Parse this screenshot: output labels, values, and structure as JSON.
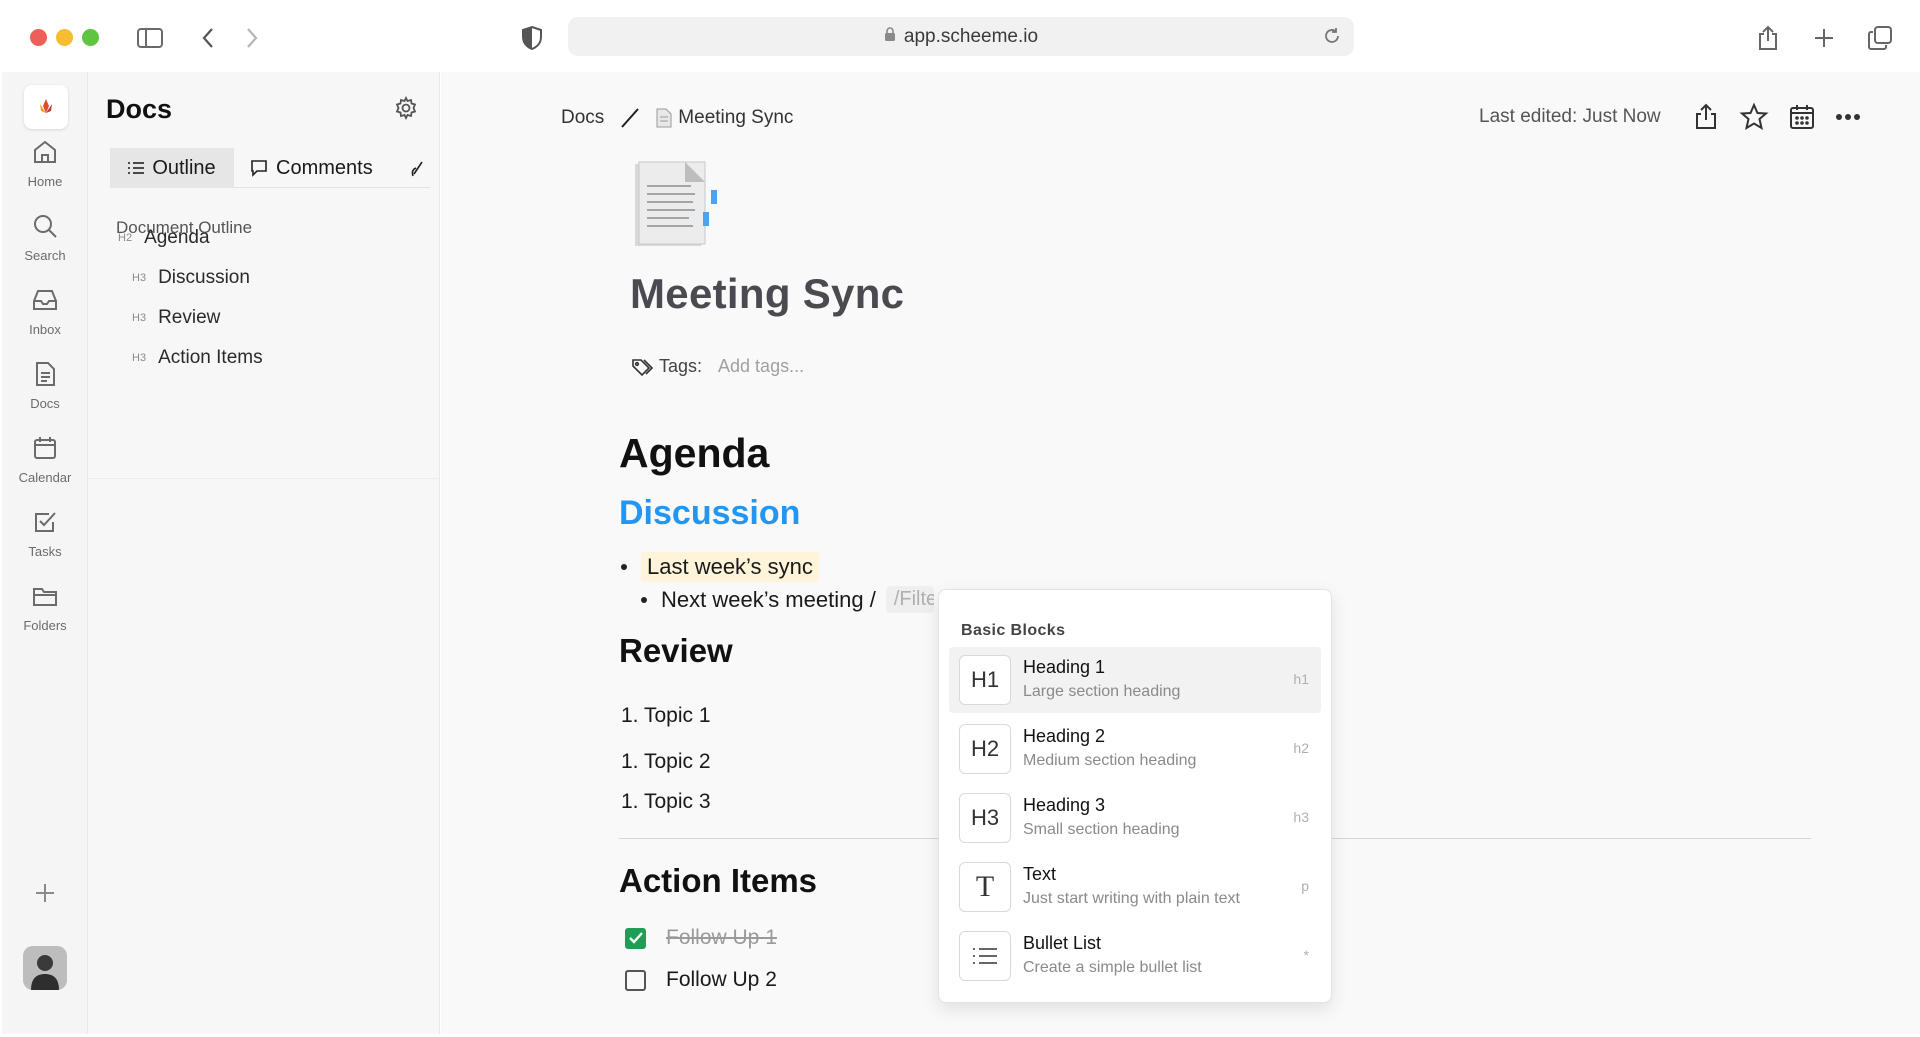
{
  "browser": {
    "url": "app.scheeme.io"
  },
  "rail": {
    "items": [
      {
        "label": "Home",
        "icon": "home-icon"
      },
      {
        "label": "Search",
        "icon": "search-icon"
      },
      {
        "label": "Inbox",
        "icon": "inbox-icon"
      },
      {
        "label": "Docs",
        "icon": "docs-icon"
      },
      {
        "label": "Calendar",
        "icon": "calendar-icon"
      },
      {
        "label": "Tasks",
        "icon": "tasks-icon"
      },
      {
        "label": "Folders",
        "icon": "folder-icon"
      }
    ]
  },
  "panel": {
    "title": "Docs",
    "tabs": {
      "outline": "Outline",
      "comments": "Comments"
    },
    "outline_heading": "Document Outline",
    "outline": [
      {
        "tag": "H2",
        "label": "Agenda"
      },
      {
        "tag": "H3",
        "label": "Discussion"
      },
      {
        "tag": "H3",
        "label": "Review"
      },
      {
        "tag": "H3",
        "label": "Action Items"
      }
    ]
  },
  "header": {
    "breadcrumb_root": "Docs",
    "breadcrumb_doc": "Meeting Sync",
    "last_edited": "Last edited: Just Now"
  },
  "doc": {
    "title": "Meeting Sync",
    "tags_label": "Tags:",
    "tags_placeholder": "Add tags...",
    "agenda": "Agenda",
    "discussion": "Discussion",
    "bullets": [
      "Last week’s sync",
      "Next week’s meeting /"
    ],
    "filter_text": "/Filter",
    "review": "Review",
    "topics": [
      "1. Topic 1",
      "1. Topic 2",
      "1. Topic 3"
    ],
    "actions_heading": "Action Items",
    "actions": [
      {
        "label": "Follow Up 1",
        "done": true
      },
      {
        "label": "Follow Up 2",
        "done": false
      }
    ]
  },
  "menu": {
    "heading": "Basic Blocks",
    "items": [
      {
        "icon": "H1",
        "title": "Heading 1",
        "desc": "Large section heading",
        "key": "h1"
      },
      {
        "icon": "H2",
        "title": "Heading 2",
        "desc": "Medium section heading",
        "key": "h2"
      },
      {
        "icon": "H3",
        "title": "Heading 3",
        "desc": "Small section heading",
        "key": "h3"
      },
      {
        "icon": "T",
        "title": "Text",
        "desc": "Just start writing with plain text",
        "key": "p"
      },
      {
        "icon": "list-icon",
        "title": "Bullet List",
        "desc": "Create a simple bullet list",
        "key": "*"
      }
    ]
  },
  "colors": {
    "accent": "#2196f3",
    "check": "#1f9d55",
    "highlight": "#fdf4d9"
  }
}
